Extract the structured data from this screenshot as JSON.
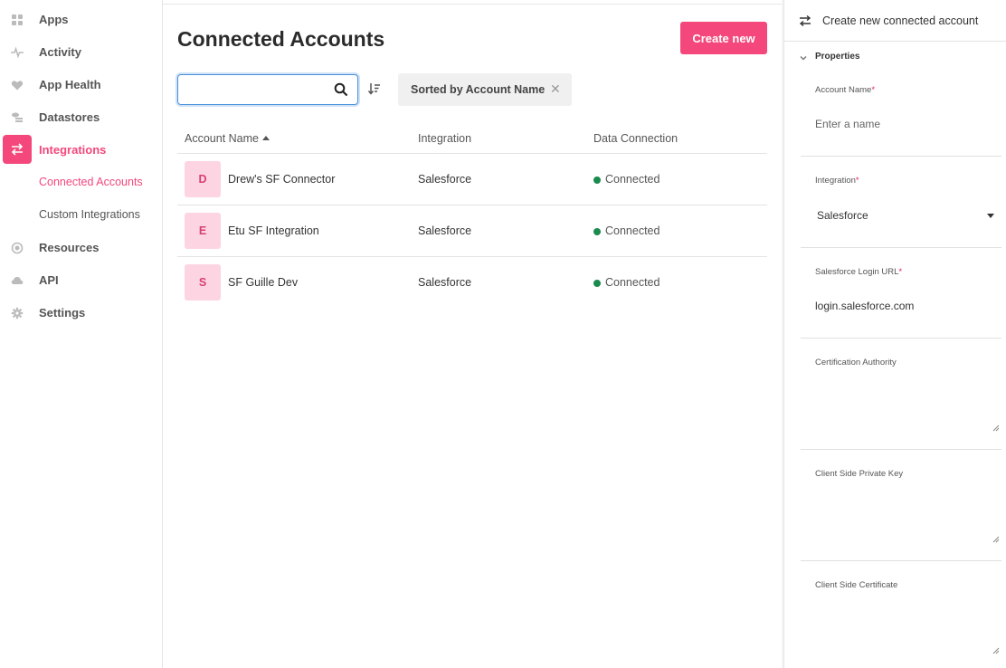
{
  "sidebar": {
    "items": [
      {
        "label": "Apps",
        "icon": "apps-grid-icon"
      },
      {
        "label": "Activity",
        "icon": "activity-pulse-icon"
      },
      {
        "label": "App Health",
        "icon": "heart-icon"
      },
      {
        "label": "Datastores",
        "icon": "datastores-icon"
      },
      {
        "label": "Integrations",
        "icon": "integrations-arrows-icon"
      },
      {
        "label": "Resources",
        "icon": "resources-target-icon"
      },
      {
        "label": "API",
        "icon": "cloud-icon"
      },
      {
        "label": "Settings",
        "icon": "gear-icon"
      }
    ],
    "sub_items": [
      {
        "label": "Connected Accounts"
      },
      {
        "label": "Custom Integrations"
      }
    ],
    "accent_color": "#f4477b"
  },
  "main": {
    "title": "Connected Accounts",
    "create_button": "Create new",
    "search": {
      "value": "",
      "placeholder": ""
    },
    "sort_chip": "Sorted by Account Name",
    "columns": [
      "Account Name",
      "Integration",
      "Data Connection"
    ],
    "rows": [
      {
        "initial": "D",
        "name": "Drew's SF Connector",
        "integration": "Salesforce",
        "status": "Connected"
      },
      {
        "initial": "E",
        "name": "Etu SF Integration",
        "integration": "Salesforce",
        "status": "Connected"
      },
      {
        "initial": "S",
        "name": "SF Guille Dev",
        "integration": "Salesforce",
        "status": "Connected"
      }
    ],
    "status_color": "#1a8a4e"
  },
  "panel": {
    "title": "Create new connected account",
    "section": "Properties",
    "fields": {
      "account_name": {
        "label": "Account Name",
        "placeholder": "Enter a name"
      },
      "integration": {
        "label": "Integration",
        "value": "Salesforce"
      },
      "login_url": {
        "label": "Salesforce Login URL",
        "value": "login.salesforce.com"
      },
      "cert_authority": {
        "label": "Certification Authority"
      },
      "private_key": {
        "label": "Client Side Private Key"
      },
      "client_cert": {
        "label": "Client Side Certificate"
      }
    },
    "required_mark": "*"
  }
}
